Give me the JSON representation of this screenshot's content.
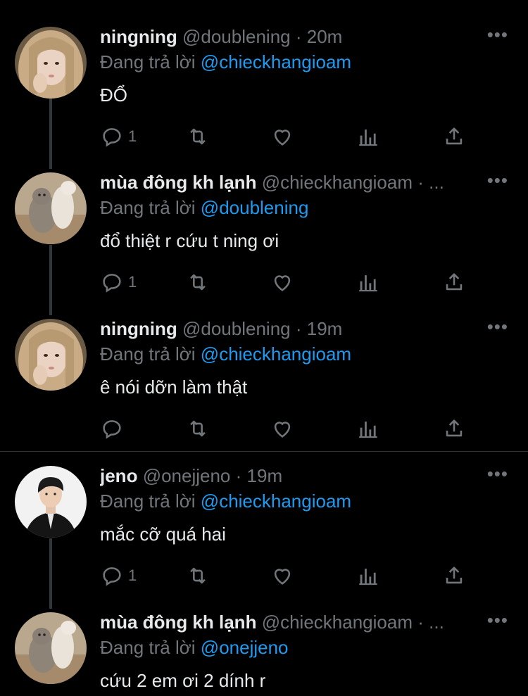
{
  "colors": {
    "background": "#000000",
    "text": "#e7e9ea",
    "muted": "#71767b",
    "link": "#1d9bf0"
  },
  "reply_prefix": "Đang trả lời",
  "more_icon": "more-dots-icon",
  "tweets": [
    {
      "name": "ningning",
      "handle": "@doublening",
      "sep": "·",
      "time": "20m",
      "reply_to": "@chieckhangioam",
      "text": "ĐỔ",
      "reply_count": "1",
      "avatar": "ningning-avatar"
    },
    {
      "name": "mùa đông kh lạnh",
      "handle": "@chieckhangioam",
      "sep": "·",
      "time": "...",
      "reply_to": "@doublening",
      "text": "đổ thiệt r cứu t ning ơi",
      "reply_count": "1",
      "avatar": "cat-avatar"
    },
    {
      "name": "ningning",
      "handle": "@doublening",
      "sep": "·",
      "time": "19m",
      "reply_to": "@chieckhangioam",
      "text": "ê nói dỡn làm thật",
      "reply_count": "",
      "avatar": "ningning-avatar"
    },
    {
      "name": "jeno",
      "handle": "@onejjeno",
      "sep": "·",
      "time": "19m",
      "reply_to": "@chieckhangioam",
      "text": "mắc cỡ quá hai",
      "reply_count": "1",
      "avatar": "jeno-avatar"
    },
    {
      "name": "mùa đông kh lạnh",
      "handle": "@chieckhangioam",
      "sep": "·",
      "time": "...",
      "reply_to": "@onejjeno",
      "text": "cứu 2 em ơi 2 dính r",
      "reply_count": "",
      "avatar": "cat-avatar"
    }
  ]
}
